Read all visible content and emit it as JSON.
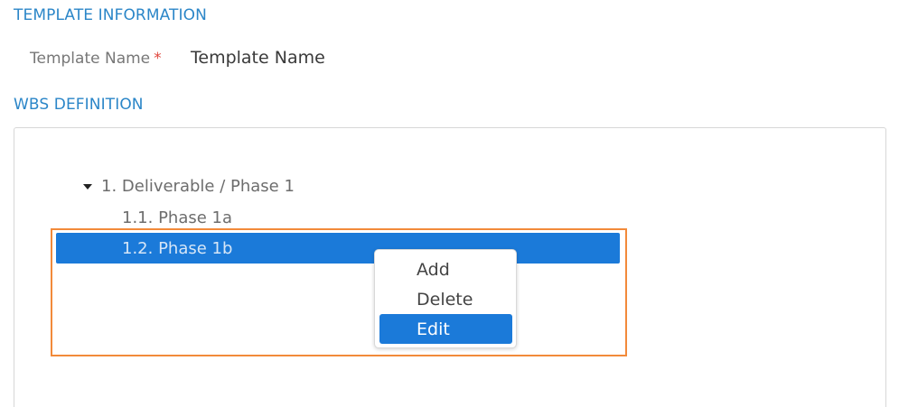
{
  "template_information": {
    "title": "TEMPLATE INFORMATION",
    "template_name_label": "Template Name",
    "required_marker": "*",
    "template_name_value": "Template Name"
  },
  "wbs_definition": {
    "title": "WBS DEFINITION",
    "tree": {
      "root": "1. Deliverable / Phase 1",
      "children": [
        "1.1. Phase 1a",
        "1.2. Phase 1b"
      ],
      "selected_index": 1,
      "root_expanded": true
    }
  },
  "context_menu": {
    "items": [
      "Add",
      "Delete",
      "Edit"
    ],
    "highlighted": "Edit"
  },
  "colors": {
    "section_title": "#2b86c8",
    "selection": "#1b7ad9",
    "highlight_frame": "#f28a3a",
    "required": "#e0463c"
  },
  "icons": {
    "expand_caret": "caret-down-icon"
  }
}
